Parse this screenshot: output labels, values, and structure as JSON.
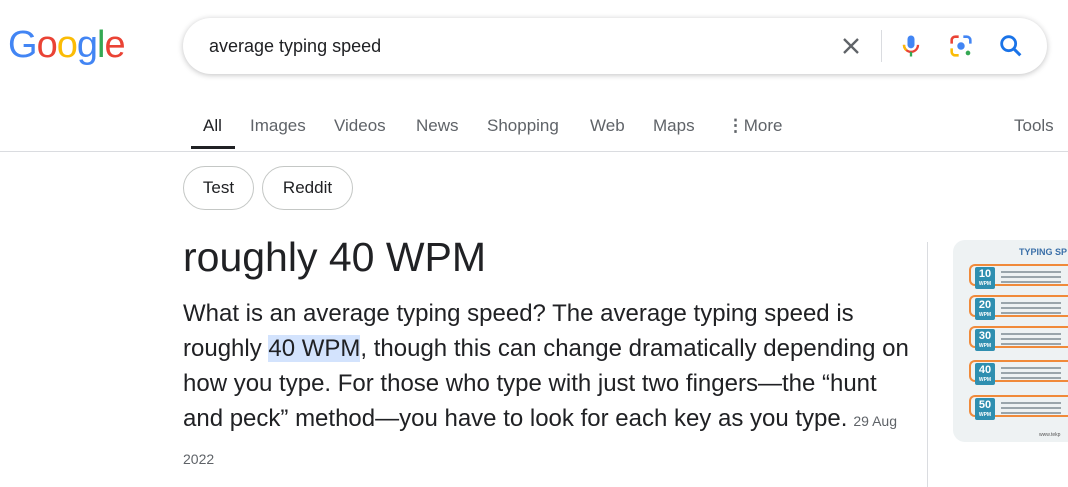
{
  "logo": {
    "letters": [
      "G",
      "o",
      "o",
      "g",
      "l",
      "e"
    ],
    "colors": [
      "#4285F4",
      "#EA4335",
      "#FBBC05",
      "#4285F4",
      "#34A853",
      "#EA4335"
    ]
  },
  "search": {
    "query": "average typing speed",
    "icons": [
      "close-icon",
      "mic-icon",
      "lens-icon",
      "search-icon"
    ]
  },
  "tabs": [
    {
      "label": "All",
      "active": true
    },
    {
      "label": "Images"
    },
    {
      "label": "Videos"
    },
    {
      "label": "News"
    },
    {
      "label": "Shopping"
    },
    {
      "label": "Web"
    },
    {
      "label": "Maps"
    },
    {
      "label": "More"
    },
    {
      "label": "Tools"
    }
  ],
  "chips": [
    "Test",
    "Reddit"
  ],
  "answer": {
    "title": "roughly 40 WPM",
    "snippet_before": "What is an average typing speed? The average typing speed is roughly ",
    "snippet_highlight": "40 WPM",
    "snippet_after": ", though this can change dramatically depending on how you type. For those who type with just two fingers—the “hunt and peck” method—you have to look for each key as you type.",
    "date": "29 Aug 2022"
  },
  "thumbnail": {
    "title": "TYPING SP",
    "levels": [
      "10",
      "20",
      "30",
      "40",
      "50"
    ],
    "unit": "WPM",
    "footer": "www.tekp"
  },
  "colors": {
    "accent_blue": "#1a73e8",
    "highlight": "#d3e3fd",
    "thumb_orange": "#f08a3a",
    "thumb_badge": "#2f8fb0"
  }
}
